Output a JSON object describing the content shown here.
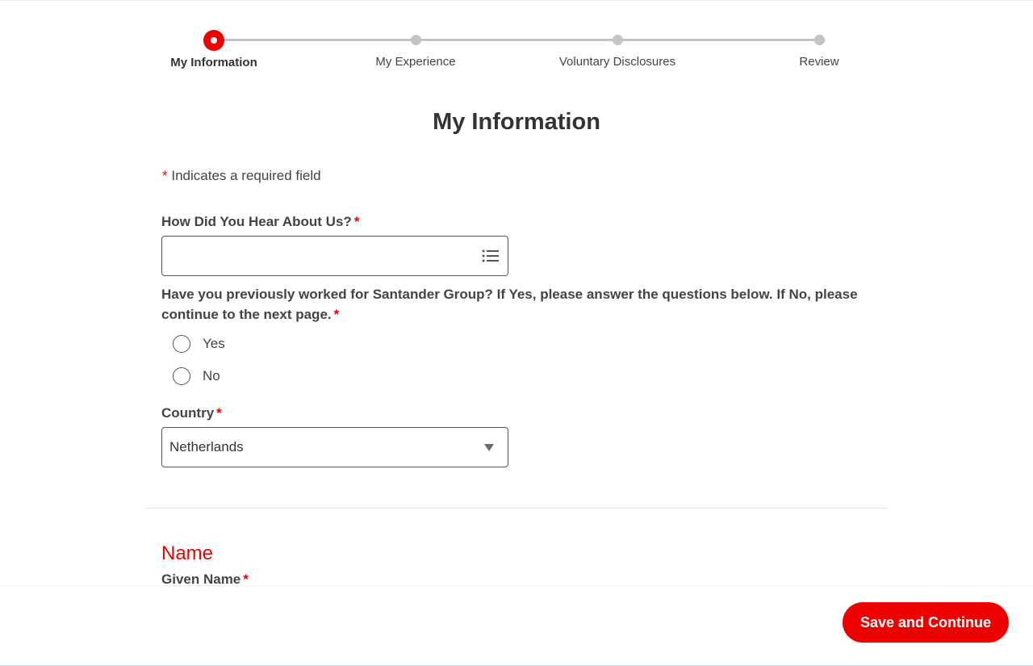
{
  "stepper": {
    "steps": [
      {
        "label": "My Information",
        "active": true
      },
      {
        "label": "My Experience",
        "active": false
      },
      {
        "label": "Voluntary Disclosures",
        "active": false
      },
      {
        "label": "Review",
        "active": false
      }
    ]
  },
  "page_title": "My Information",
  "required_note": {
    "asterisk": "*",
    "text": "Indicates a required field"
  },
  "fields": {
    "hear_about": {
      "label": "How Did You Hear About Us?",
      "required_mark": "*",
      "value": "",
      "icon": "list-icon"
    },
    "previous_work": {
      "label": "Have you previously worked for Santander Group? If Yes, please answer the questions below. If No, please continue to the next page.",
      "required_mark": "*",
      "options": [
        "Yes",
        "No"
      ]
    },
    "country": {
      "label": "Country",
      "required_mark": "*",
      "value": "Netherlands",
      "icon": "chevron-down-icon"
    }
  },
  "name_section": {
    "title": "Name",
    "given_name_label": "Given Name",
    "required_mark": "*"
  },
  "footer": {
    "save_label": "Save and Continue"
  },
  "colors": {
    "accent": "#ec0000",
    "inactive_step": "#c4c4c4",
    "text": "#333333"
  }
}
